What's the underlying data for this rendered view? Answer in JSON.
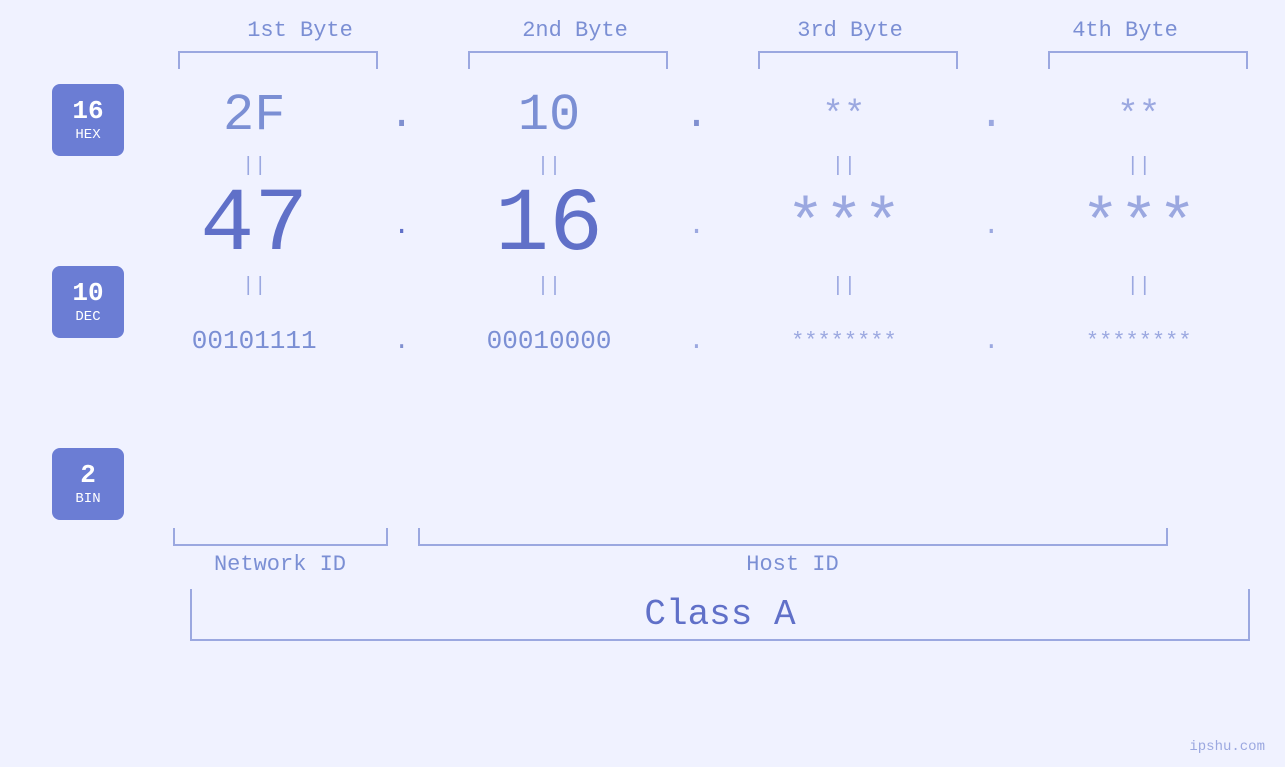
{
  "byteLabels": [
    "1st Byte",
    "2nd Byte",
    "3rd Byte",
    "4th Byte"
  ],
  "badges": [
    {
      "number": "16",
      "label": "HEX"
    },
    {
      "number": "10",
      "label": "DEC"
    },
    {
      "number": "2",
      "label": "BIN"
    }
  ],
  "hexRow": {
    "values": [
      "2F",
      "10",
      "**",
      "**"
    ],
    "dots": [
      ".",
      ".",
      ".",
      "."
    ]
  },
  "decRow": {
    "values": [
      "47",
      "16",
      "***",
      "***"
    ],
    "dots": [
      ".",
      ".",
      ".",
      "."
    ]
  },
  "binRow": {
    "values": [
      "00101111",
      "00010000",
      "********",
      "********"
    ],
    "dots": [
      ".",
      ".",
      ".",
      "."
    ]
  },
  "networkIdLabel": "Network ID",
  "hostIdLabel": "Host ID",
  "classLabel": "Class A",
  "watermark": "ipshu.com",
  "colors": {
    "accent": "#6070c8",
    "medium": "#7b8fd4",
    "light": "#9ba8e0",
    "masked": "#b0bce8",
    "badge": "#6b7dd4",
    "bg": "#f0f2ff"
  }
}
